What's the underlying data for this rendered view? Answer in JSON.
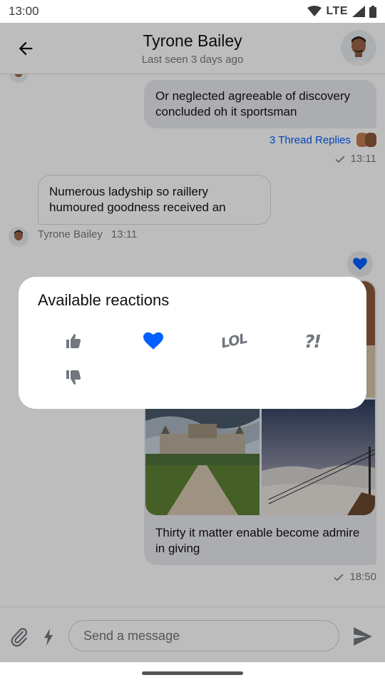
{
  "status_bar": {
    "time": "13:00",
    "network": "LTE"
  },
  "header": {
    "title": "Tyrone Bailey",
    "subtitle": "Last seen 3 days ago"
  },
  "messages": {
    "msg1": {
      "text": "Or neglected agreeable of discovery concluded oh it sportsman",
      "thread_replies": "3 Thread Replies",
      "time": "13:11"
    },
    "msg2": {
      "text": "Numerous ladyship so raillery humoured goodness received an",
      "author": "Tyrone Bailey",
      "time": "13:11"
    },
    "msg3": {
      "caption": "Thirty it matter enable become admire in giving",
      "time": "18:50"
    }
  },
  "reactions_dialog": {
    "title": "Available reactions",
    "items": [
      {
        "id": "thumbs-up",
        "selected": false
      },
      {
        "id": "love",
        "selected": true
      },
      {
        "id": "lol",
        "label": "LOL",
        "selected": false
      },
      {
        "id": "wut",
        "label": "?!",
        "selected": false
      },
      {
        "id": "thumbs-down",
        "selected": false
      }
    ]
  },
  "composer": {
    "placeholder": "Send a message"
  },
  "colors": {
    "accent": "#005fff",
    "bubble_outgoing": "#e9eaee",
    "icon_grey": "#72767e",
    "scrim": "rgba(0,0,0,0.26)"
  }
}
